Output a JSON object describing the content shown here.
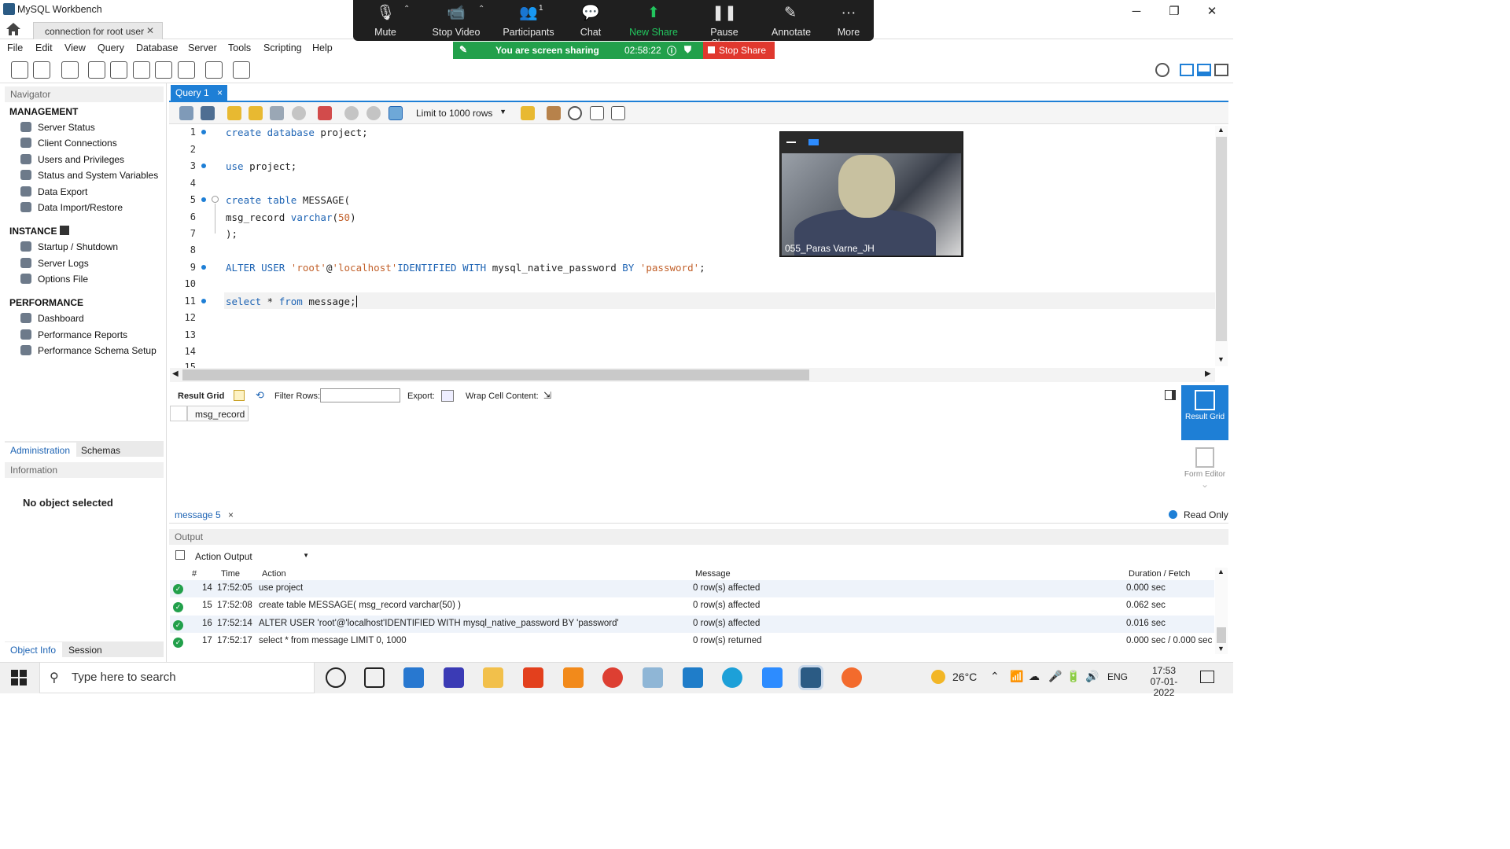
{
  "window": {
    "title": "MySQL Workbench",
    "tab": "connection for root user",
    "tab_close": "✕",
    "minimize": "─",
    "restore": "❐",
    "close": "✕"
  },
  "menu": [
    "File",
    "Edit",
    "View",
    "Query",
    "Database",
    "Server",
    "Tools",
    "Scripting",
    "Help"
  ],
  "zoom": {
    "mute": "Mute",
    "stop_video": "Stop Video",
    "participants": "Participants",
    "participants_count": "1",
    "chat": "Chat",
    "new_share": "New Share",
    "pause_share": "Pause Share",
    "annotate": "Annotate",
    "more": "More",
    "sharing_text": "You are screen sharing",
    "timer": "02:58:22",
    "stop_share": "Stop Share"
  },
  "navigator": {
    "header": "Navigator",
    "management": "MANAGEMENT",
    "management_items": [
      "Server Status",
      "Client Connections",
      "Users and Privileges",
      "Status and System Variables",
      "Data Export",
      "Data Import/Restore"
    ],
    "instance": "INSTANCE",
    "instance_items": [
      "Startup / Shutdown",
      "Server Logs",
      "Options File"
    ],
    "performance": "PERFORMANCE",
    "performance_items": [
      "Dashboard",
      "Performance Reports",
      "Performance Schema Setup"
    ],
    "tab_admin": "Administration",
    "tab_schemas": "Schemas",
    "info_header": "Information",
    "no_object": "No object selected",
    "tab_objinfo": "Object Info",
    "tab_session": "Session"
  },
  "query": {
    "tab": "Query 1",
    "tab_close": "×",
    "limit": "Limit to 1000 rows"
  },
  "line_numbers": [
    "1",
    "2",
    "3",
    "4",
    "5",
    "6",
    "7",
    "8",
    "9",
    "10",
    "11",
    "12",
    "13",
    "14",
    "15"
  ],
  "video": {
    "name": "055_Paras Varne_JH"
  },
  "result": {
    "grid_label": "Result Grid",
    "filter_label": "Filter Rows:",
    "export_label": "Export:",
    "wrap_label": "Wrap Cell Content:",
    "column": "msg_record",
    "result_grid_btn": "Result Grid",
    "form_editor_btn": "Form Editor",
    "read_only": "Read Only"
  },
  "message_tab": "message 5",
  "message_tab_close": "×",
  "output": {
    "header": "Output",
    "selector": "Action Output",
    "columns": [
      "#",
      "Time",
      "Action",
      "Message",
      "Duration / Fetch"
    ],
    "rows": [
      {
        "n": "14",
        "time": "17:52:05",
        "action": "use project",
        "message": "0 row(s) affected",
        "duration": "0.000 sec"
      },
      {
        "n": "15",
        "time": "17:52:08",
        "action": "create table MESSAGE( msg_record varchar(50) )",
        "message": "0 row(s) affected",
        "duration": "0.062 sec"
      },
      {
        "n": "16",
        "time": "17:52:14",
        "action": "ALTER USER 'root'@'localhost'IDENTIFIED WITH mysql_native_password BY 'password'",
        "message": "0 row(s) affected",
        "duration": "0.016 sec"
      },
      {
        "n": "17",
        "time": "17:52:17",
        "action": "select * from message LIMIT 0, 1000",
        "message": "0 row(s) returned",
        "duration": "0.000 sec / 0.000 sec"
      }
    ]
  },
  "taskbar": {
    "search_placeholder": "Type here to search",
    "weather": "26°C",
    "lang": "ENG",
    "time": "17:53",
    "date": "07-01-2022"
  }
}
